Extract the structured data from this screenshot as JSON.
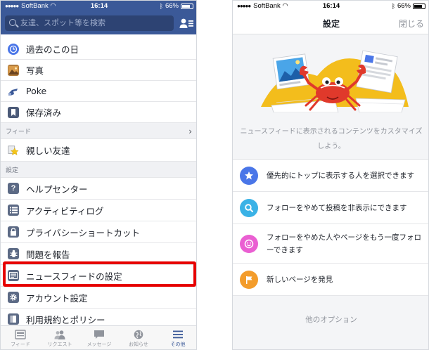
{
  "left": {
    "status": {
      "carrier": "SoftBank",
      "time": "16:14",
      "battery": "66%"
    },
    "search": {
      "placeholder": "友達、スポット等を検索"
    },
    "items_top": [
      {
        "label": "過去のこの日",
        "icon": "clock-icon"
      },
      {
        "label": "写真",
        "icon": "photo-icon"
      },
      {
        "label": "Poke",
        "icon": "poke-icon"
      },
      {
        "label": "保存済み",
        "icon": "bookmark-icon"
      }
    ],
    "section_feed": "フィード",
    "items_feed": [
      {
        "label": "親しい友達",
        "icon": "star-icon"
      }
    ],
    "section_settings": "設定",
    "items_settings": [
      {
        "label": "ヘルプセンター",
        "icon": "help-icon"
      },
      {
        "label": "アクティビティログ",
        "icon": "list-icon"
      },
      {
        "label": "プライバシーショートカット",
        "icon": "lock-icon"
      },
      {
        "label": "問題を報告",
        "icon": "bug-icon"
      },
      {
        "label": "ニュースフィードの設定",
        "icon": "newsfeed-icon"
      },
      {
        "label": "アカウント設定",
        "icon": "gear-icon"
      },
      {
        "label": "利用規約とポリシー",
        "icon": "book-icon"
      }
    ],
    "tabs": [
      {
        "label": "フィード",
        "icon": "feed-icon"
      },
      {
        "label": "リクエスト",
        "icon": "friends-icon"
      },
      {
        "label": "メッセージ",
        "icon": "message-icon"
      },
      {
        "label": "お知らせ",
        "icon": "globe-icon"
      },
      {
        "label": "その他",
        "icon": "menu-icon"
      }
    ],
    "colors": {
      "brand": "#3b5998",
      "highlight": "#e60000"
    }
  },
  "right": {
    "status": {
      "carrier": "SoftBank",
      "time": "16:14",
      "battery": "66%"
    },
    "title": "設定",
    "close": "閉じる",
    "description": "ニュースフィードに表示されるコンテンツをカスタマイズしよう。",
    "options": [
      {
        "text": "優先的にトップに表示する人を選択できます",
        "icon": "star-icon",
        "color": "#4a76e8"
      },
      {
        "text": "フォローをやめて投稿を非表示にできます",
        "icon": "search-icon",
        "color": "#3ab2e6"
      },
      {
        "text": "フォローをやめた人やページをもう一度フォローできます",
        "icon": "smile-icon",
        "color": "#ea5fd2"
      },
      {
        "text": "新しいページを発見",
        "icon": "flag-icon",
        "color": "#f39c2b"
      }
    ],
    "more": "他のオプション"
  }
}
